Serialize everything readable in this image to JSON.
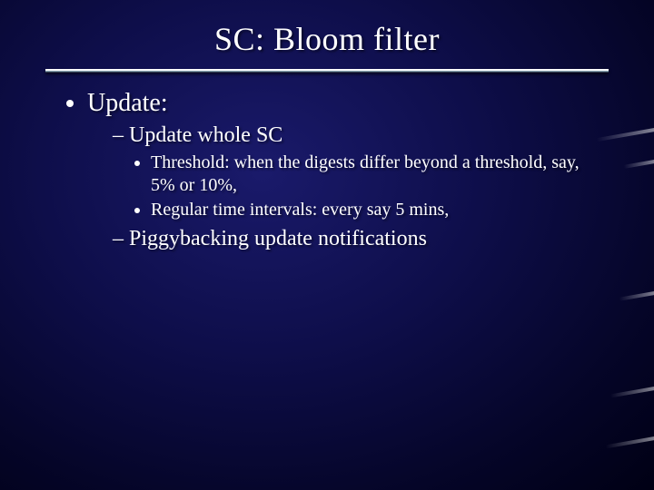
{
  "title": "SC: Bloom filter",
  "content": {
    "bullets": [
      {
        "label": "Update:",
        "children": [
          {
            "label": "Update whole SC",
            "children": [
              {
                "label": "Threshold: when the digests differ beyond a threshold, say, 5% or 10%,"
              },
              {
                "label": "Regular time intervals: every say 5 mins,"
              }
            ]
          },
          {
            "label": "Piggybacking update notifications"
          }
        ]
      }
    ]
  }
}
